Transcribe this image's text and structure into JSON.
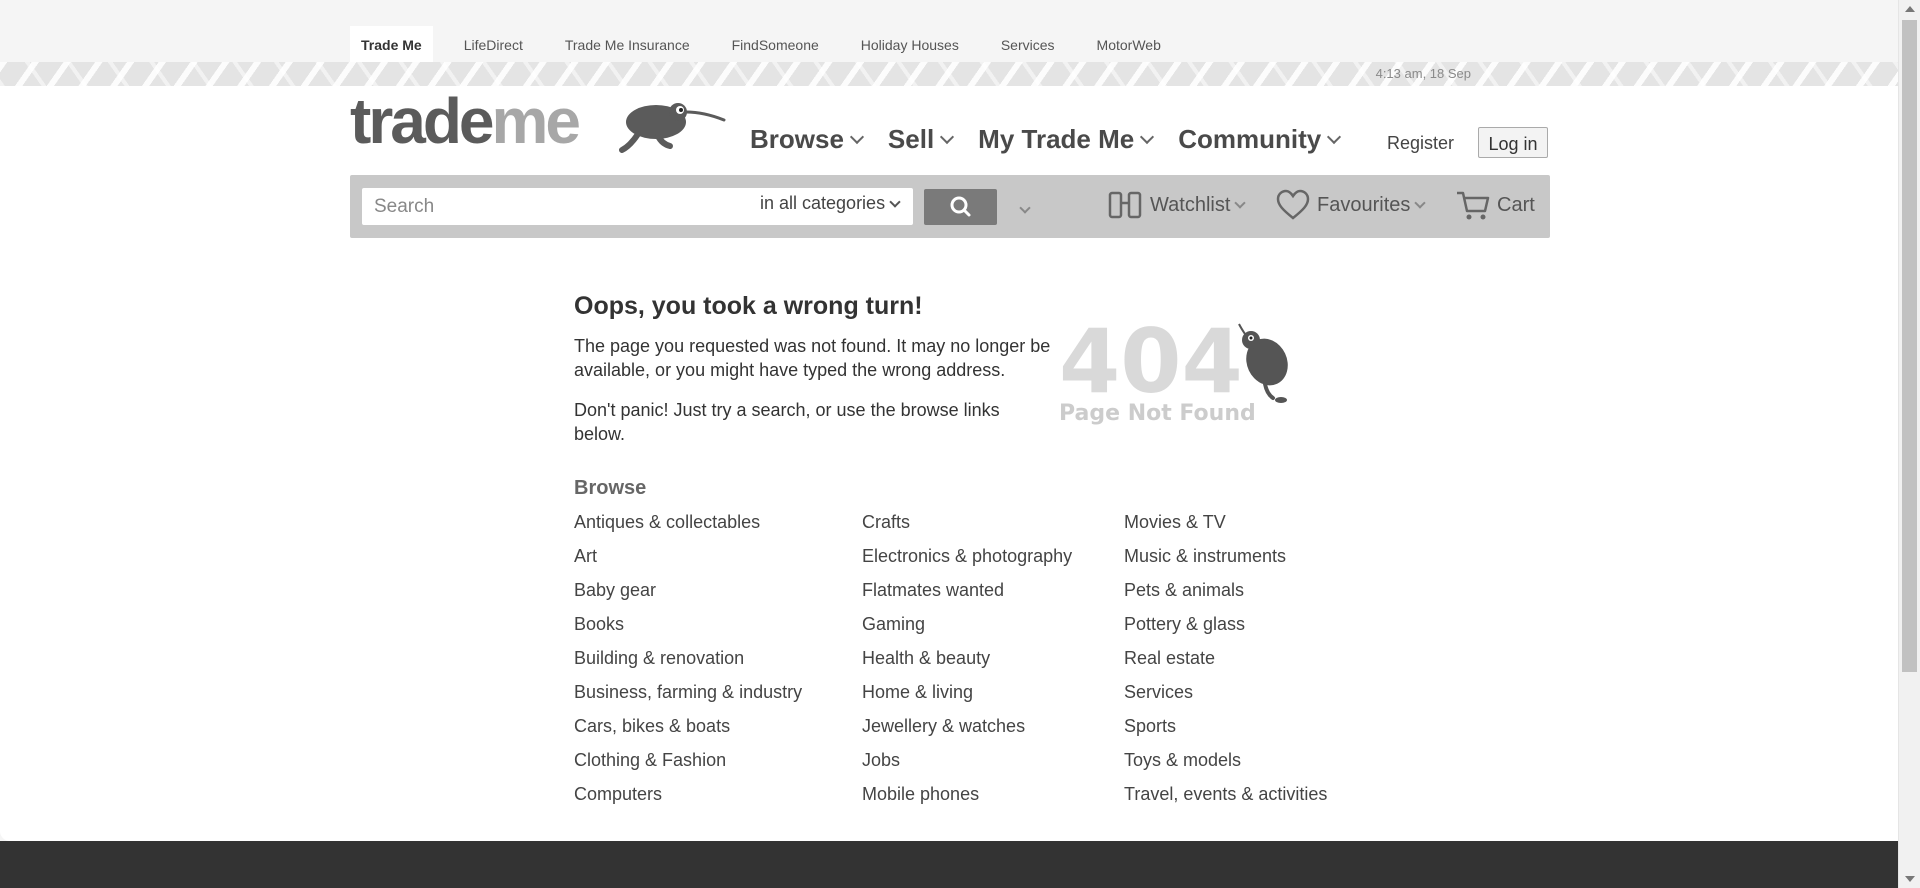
{
  "sites": [
    "Trade Me",
    "LifeDirect",
    "Trade Me Insurance",
    "FindSomeone",
    "Holiday Houses",
    "Services",
    "MotorWeb"
  ],
  "datetime": "4:13 am, 18 Sep",
  "logo": {
    "part1": "trade",
    "part2": "me"
  },
  "nav": {
    "browse": "Browse",
    "sell": "Sell",
    "mytrademe": "My Trade Me",
    "community": "Community",
    "register": "Register",
    "login": "Log in"
  },
  "search": {
    "placeholder": "Search",
    "category": "in all categories"
  },
  "tools": {
    "watchlist": "Watchlist",
    "favourites": "Favourites",
    "cart": "Cart"
  },
  "error": {
    "title": "Oops, you took a wrong turn!",
    "text1": "The page you requested was not found. It may no longer be available, or you might have typed the wrong address.",
    "text2": "Don't panic! Just try a search, or use the browse links below.",
    "image_number": "404",
    "image_caption": "Page Not Found"
  },
  "browse": {
    "heading": "Browse",
    "col1": [
      "Antiques & collectables",
      "Art",
      "Baby gear",
      "Books",
      "Building & renovation",
      "Business, farming & industry",
      "Cars, bikes & boats",
      "Clothing & Fashion",
      "Computers"
    ],
    "col2": [
      "Crafts",
      "Electronics & photography",
      "Flatmates wanted",
      "Gaming",
      "Health & beauty",
      "Home & living",
      "Jewellery & watches",
      "Jobs",
      "Mobile phones"
    ],
    "col3": [
      "Movies & TV",
      "Music & instruments",
      "Pets & animals",
      "Pottery & glass",
      "Real estate",
      "Services",
      "Sports",
      "Toys & models",
      "Travel, events & activities"
    ]
  }
}
